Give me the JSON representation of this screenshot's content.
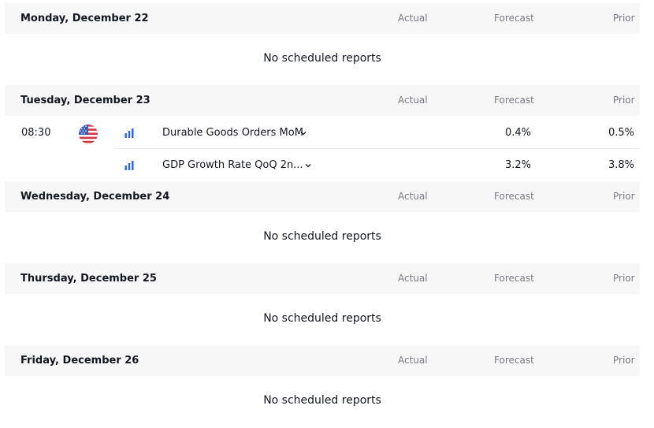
{
  "columns": {
    "actual": "Actual",
    "forecast": "Forecast",
    "prior": "Prior"
  },
  "days": [
    {
      "title": "Monday, December 22",
      "empty_text": "No scheduled reports"
    },
    {
      "title": "Tuesday, December 23",
      "events": [
        {
          "time": "08:30",
          "country_icon": "us-flag-icon",
          "importance_icon": "importance-bars-icon",
          "name": "Durable Goods Orders MoM",
          "forecast": "0.4%",
          "prior": "0.5%"
        },
        {
          "time": "",
          "importance_icon": "importance-bars-icon",
          "name": "GDP Growth Rate QoQ 2n...",
          "forecast": "3.2%",
          "prior": "3.8%"
        }
      ]
    },
    {
      "title": "Wednesday, December 24",
      "empty_text": "No scheduled reports"
    },
    {
      "title": "Thursday, December 25",
      "empty_text": "No scheduled reports"
    },
    {
      "title": "Friday, December 26",
      "empty_text": "No scheduled reports"
    }
  ],
  "colors": {
    "header_bg": "#f7f7f7",
    "muted_text": "#787b86",
    "importance_bar": "#2962ff"
  }
}
